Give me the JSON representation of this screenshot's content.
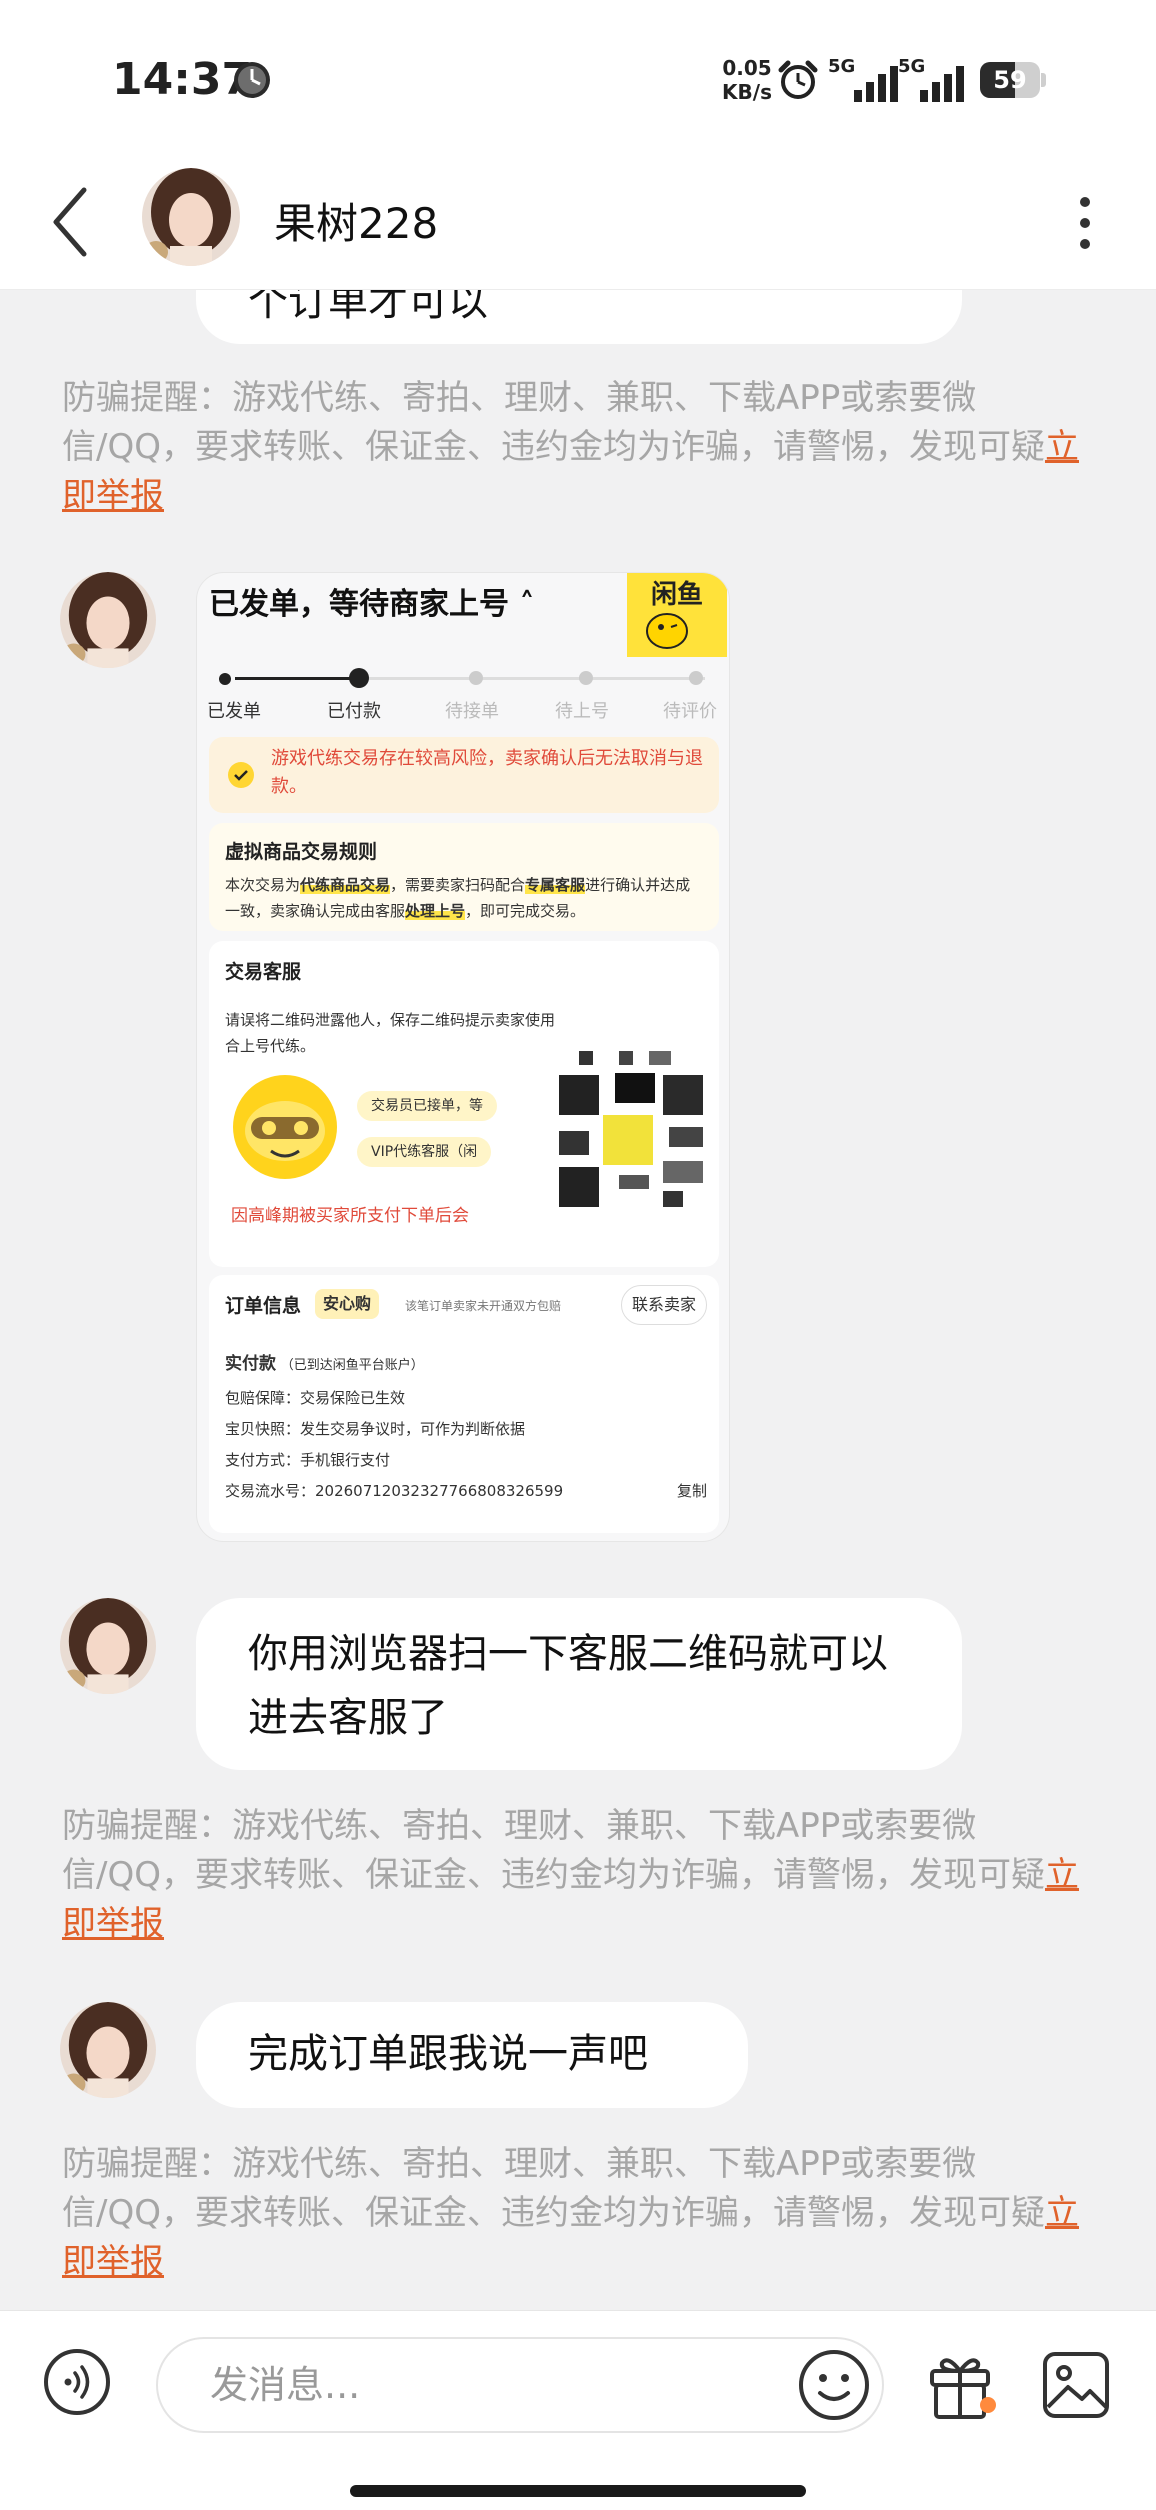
{
  "status_bar": {
    "time": "14:37",
    "net_speed_value": "0.05",
    "net_speed_unit": "KB/s",
    "signal1": "5G",
    "signal2": "5G",
    "battery": "59",
    "battery_level": 0.59
  },
  "header": {
    "title": "果树228"
  },
  "messages": {
    "partial_text": "个订单才可以",
    "warning_text": "防骗提醒：游戏代练、寄拍、理财、兼职、下载APP或索要微信/QQ，要求转账、保证金、违约金均为诈骗，请警惕，发现可疑",
    "report_link": "立即举报",
    "msg2": "你用浏览器扫一下客服二维码就可以进去客服了",
    "msg3": "完成订单跟我说一声吧"
  },
  "screenshot_card": {
    "title": "已发单，等待商家上号 ˄",
    "logo_text": "闲鱼",
    "steps": [
      "已发单",
      "已付款",
      "待接单",
      "待上号",
      "待评价"
    ],
    "notice": "游戏代练交易存在较高风险，卖家确认后无法取消与退款。",
    "rules_title": "虚拟商品交易规则",
    "rules_text_1": "本次交易为",
    "rules_hl_1": "代练商品交易",
    "rules_text_2": "，需要卖家扫码配合",
    "rules_hl_2": "专属客服",
    "rules_text_3": "进行确认并达成一致，卖家确认完成由客服",
    "rules_hl_3": "处理上号",
    "rules_text_4": "，即可完成交易。",
    "service_title": "交易客服",
    "service_desc": "请误将二维码泄露他人，保存二维码提示卖家使用",
    "service_desc_2": "合上号代练。",
    "tag1": "交易员已接单，等",
    "tag2": "VIP代练客服（闲",
    "alert": "因高峰期被买家所支付下单后会",
    "order_title": "订单信息",
    "badge": "安心购",
    "badge_note": "该笔订单卖家未开通双方包赔",
    "contact_seller": "联系卖家",
    "paid_label": "实付款",
    "paid_note": "（已到达闲鱼平台账户）",
    "row_protect": "包赔保障：交易保险已生效",
    "row_snapshot": "宝贝快照：发生交易争议时，可作为判断依据",
    "row_payment": "支付方式：手机银行支付",
    "row_serial": "交易流水号：20260712032327766808326599",
    "copy": "复制"
  },
  "input_bar": {
    "placeholder": "发消息..."
  },
  "colors": {
    "link": "#e0622b",
    "warning_text": "#a6a6a6",
    "background": "#f1f1f2"
  },
  "icons": [
    "back-arrow-icon",
    "more-dots-icon",
    "voice-icon",
    "emoji-icon",
    "gift-icon",
    "image-icon",
    "alarm-icon",
    "clock-icon"
  ]
}
